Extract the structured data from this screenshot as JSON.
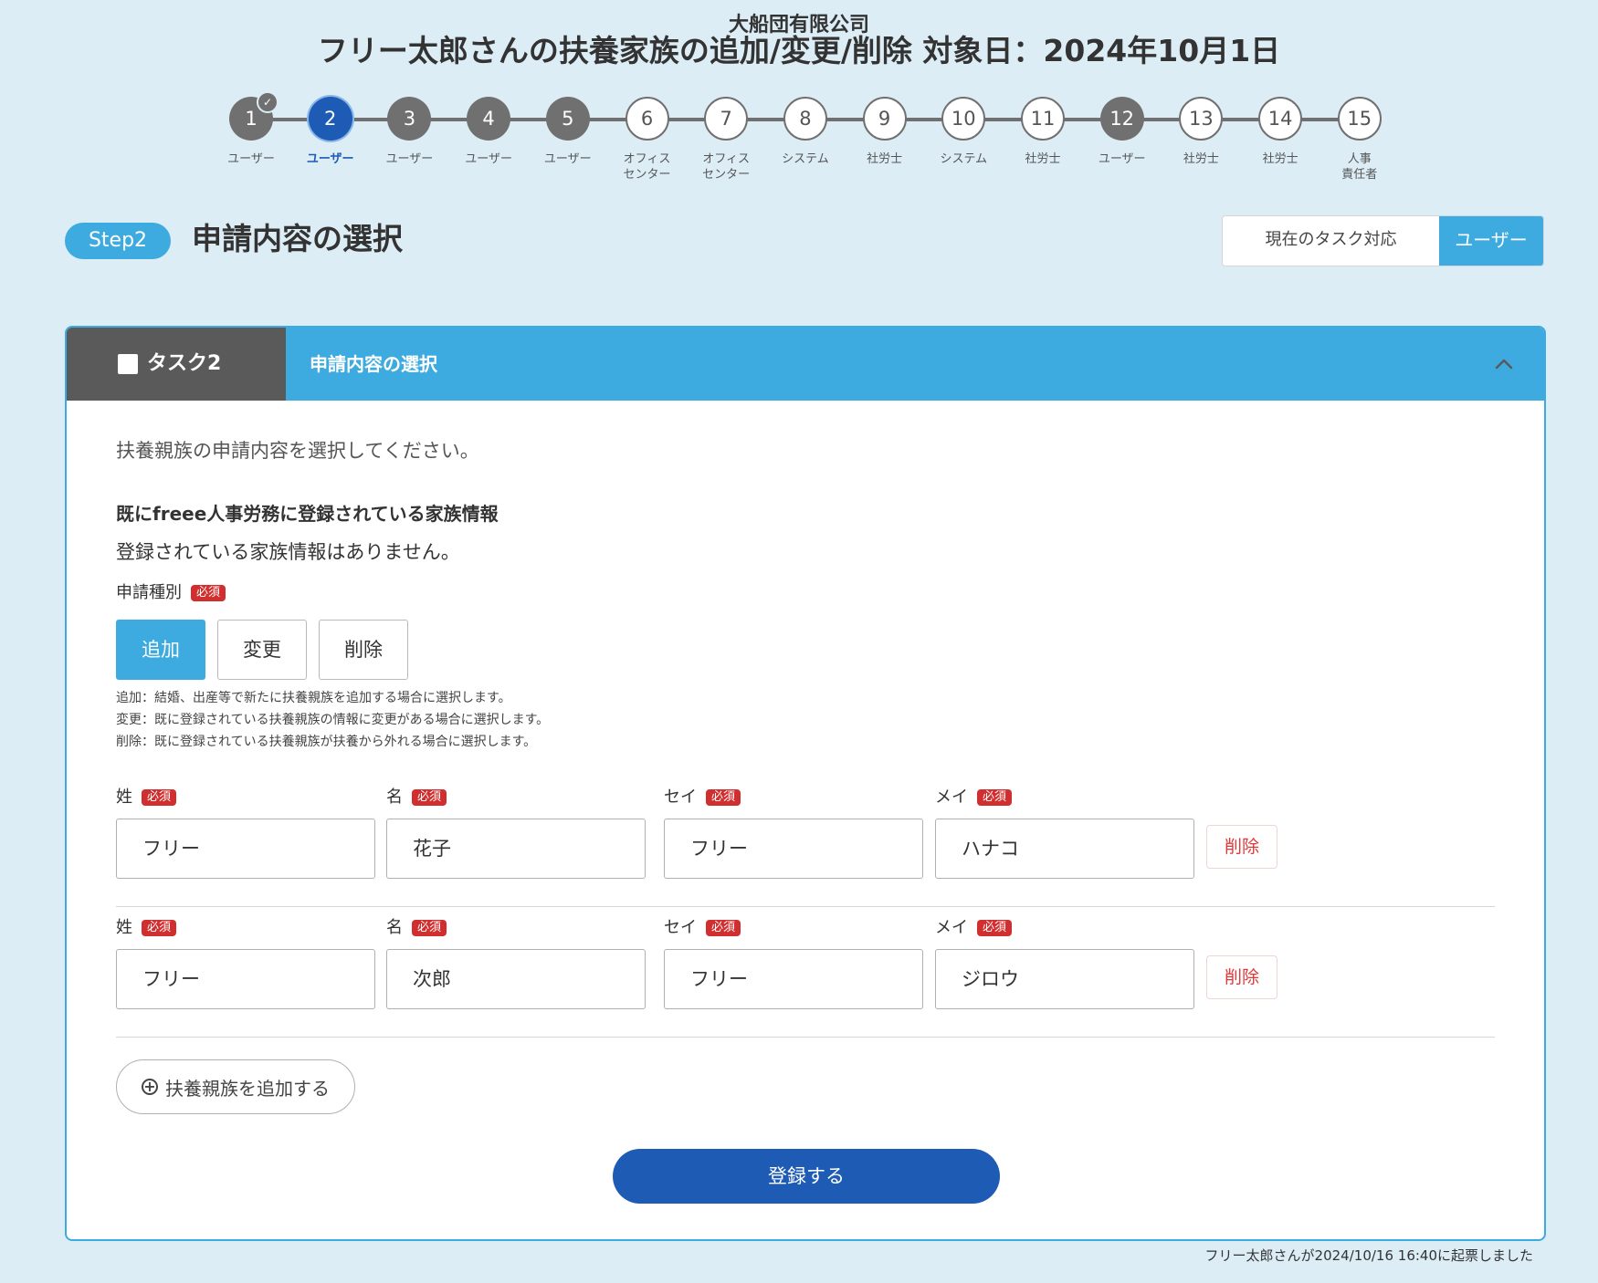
{
  "header": {
    "company": "大船団有限公司",
    "title": "フリー太郎さんの扶養家族の追加/変更/削除 対象日：2024年10月1日"
  },
  "steps": [
    {
      "num": "1",
      "label": "ユーザー",
      "state": "done"
    },
    {
      "num": "2",
      "label": "ユーザー",
      "state": "current"
    },
    {
      "num": "3",
      "label": "ユーザー",
      "state": "done"
    },
    {
      "num": "4",
      "label": "ユーザー",
      "state": "done"
    },
    {
      "num": "5",
      "label": "ユーザー",
      "state": "done"
    },
    {
      "num": "6",
      "label": "オフィス\nセンター",
      "state": "pending"
    },
    {
      "num": "7",
      "label": "オフィス\nセンター",
      "state": "pending"
    },
    {
      "num": "8",
      "label": "システム",
      "state": "pending"
    },
    {
      "num": "9",
      "label": "社労士",
      "state": "pending"
    },
    {
      "num": "10",
      "label": "システム",
      "state": "pending"
    },
    {
      "num": "11",
      "label": "社労士",
      "state": "pending"
    },
    {
      "num": "12",
      "label": "ユーザー",
      "state": "done"
    },
    {
      "num": "13",
      "label": "社労士",
      "state": "pending"
    },
    {
      "num": "14",
      "label": "社労士",
      "state": "pending"
    },
    {
      "num": "15",
      "label": "人事\n責任者",
      "state": "pending"
    }
  ],
  "step": {
    "badge": "Step2",
    "title": "申請内容の選択"
  },
  "current_task": {
    "label": "現在のタスク対応",
    "value": "ユーザー"
  },
  "card": {
    "task_label": "タスク2",
    "title": "申請内容の選択",
    "intro": "扶養親族の申請内容を選択してください。",
    "registered_title": "既にfreee人事労務に登録されている家族情報",
    "registered_empty": "登録されている家族情報はありません。",
    "type_label": "申請種別",
    "required": "必須",
    "type_buttons": [
      {
        "label": "追加",
        "selected": true
      },
      {
        "label": "変更",
        "selected": false
      },
      {
        "label": "削除",
        "selected": false
      }
    ],
    "type_descriptions": [
      "追加：結婚、出産等で新たに扶養親族を追加する場合に選択します。",
      "変更：既に登録されている扶養親族の情報に変更がある場合に選択します。",
      "削除：既に登録されている扶養親族が扶養から外れる場合に選択します。"
    ],
    "field_labels": {
      "last_name": "姓",
      "first_name": "名",
      "last_kana": "セイ",
      "first_kana": "メイ"
    },
    "family": [
      {
        "last_name": "フリー",
        "first_name": "花子",
        "last_kana": "フリー",
        "first_kana": "ハナコ"
      },
      {
        "last_name": "フリー",
        "first_name": "次郎",
        "last_kana": "フリー",
        "first_kana": "ジロウ"
      }
    ],
    "delete_label": "削除",
    "add_family_label": "扶養親族を追加する",
    "submit_label": "登録する"
  },
  "footer_note": "フリー太郎さんが2024/10/16 16:40に起票しました",
  "colors": {
    "background": "#dcedf5",
    "accent": "#3dabe0",
    "primary": "#1e5bb5",
    "done_step": "#707070",
    "required_badge": "#d12f2f",
    "delete_text": "#e03838"
  }
}
